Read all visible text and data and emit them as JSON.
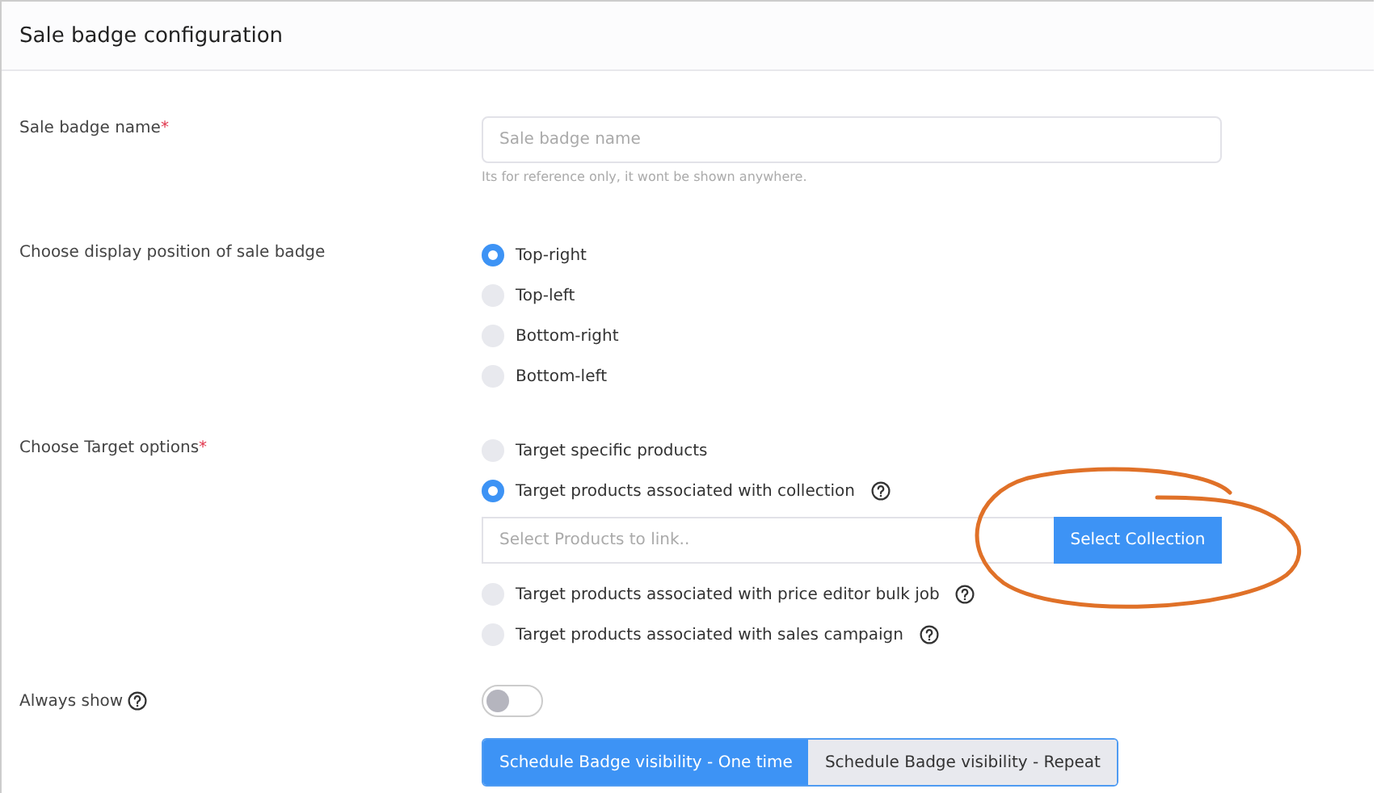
{
  "header": {
    "title": "Sale badge configuration"
  },
  "name_field": {
    "label": "Sale badge name",
    "required_mark": "*",
    "placeholder": "Sale badge name",
    "hint": "Its for reference only, it wont be shown anywhere."
  },
  "position": {
    "label": "Choose display position of sale badge",
    "options": [
      {
        "label": "Top-right",
        "selected": true
      },
      {
        "label": "Top-left",
        "selected": false
      },
      {
        "label": "Bottom-right",
        "selected": false
      },
      {
        "label": "Bottom-left",
        "selected": false
      }
    ]
  },
  "target": {
    "label": "Choose Target options",
    "required_mark": "*",
    "options": [
      {
        "label": "Target specific products",
        "selected": false,
        "help": false
      },
      {
        "label": "Target products associated with collection",
        "selected": true,
        "help": true
      },
      {
        "label": "Target products associated with price editor bulk job",
        "selected": false,
        "help": true
      },
      {
        "label": "Target products associated with sales campaign",
        "selected": false,
        "help": true
      }
    ],
    "picker": {
      "placeholder": "Select Products to link..",
      "button": "Select Collection"
    }
  },
  "always_show": {
    "label": "Always show",
    "help": true,
    "on": false
  },
  "schedule_tabs": [
    {
      "label": "Schedule Badge visibility - One time",
      "selected": true
    },
    {
      "label": "Schedule Badge visibility - Repeat",
      "selected": false
    }
  ]
}
